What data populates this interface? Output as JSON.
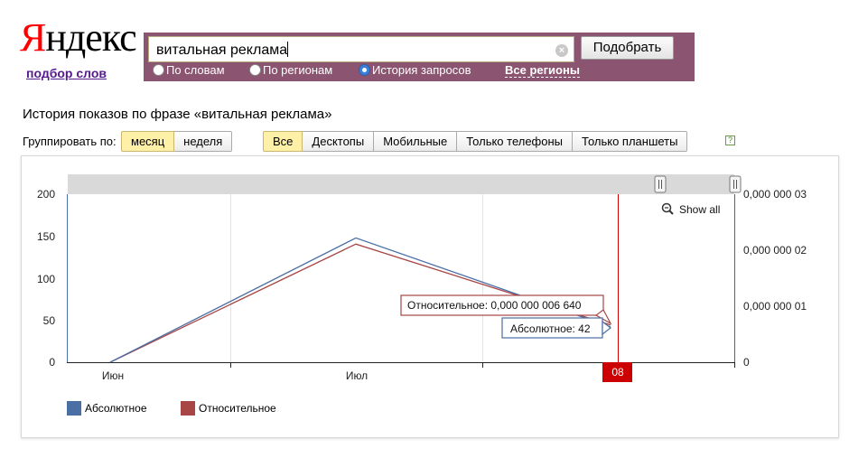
{
  "logo": {
    "first": "Я",
    "rest": "ндекс"
  },
  "logo_link": "подбор слов",
  "search": {
    "value": "витальная реклама",
    "button": "Подобрать",
    "clear": "×"
  },
  "radios": [
    {
      "label": "По словам",
      "checked": false
    },
    {
      "label": "По регионам",
      "checked": false
    },
    {
      "label": "История запросов",
      "checked": true
    }
  ],
  "regions_link": "Все регионы",
  "history_title": "История показов по фразе «витальная реклама»",
  "group_by": {
    "label": "Группировать по:",
    "options": [
      "месяц",
      "неделя"
    ],
    "active": "месяц"
  },
  "device_filter": {
    "options": [
      "Все",
      "Десктопы",
      "Мобильные",
      "Только телефоны",
      "Только планшеты"
    ],
    "active": "Все"
  },
  "help_icon": "?",
  "colors": {
    "absolute": "#4a6fa5",
    "relative": "#a84545",
    "panel": "#8b5470",
    "marker": "#cc0000"
  },
  "chart_data": {
    "type": "line",
    "categories": [
      "Июн",
      "Июл",
      "Авг"
    ],
    "series": [
      {
        "name": "Абсолютное",
        "values": [
          0,
          148,
          42
        ]
      },
      {
        "name": "Относительное",
        "values": [
          0,
          2.11e-08,
          6.64e-09
        ]
      }
    ],
    "y_left": {
      "ticks": [
        "0",
        "50",
        "100",
        "150",
        "200"
      ],
      "range": [
        0,
        200
      ]
    },
    "y_right": {
      "ticks": [
        "0",
        "0,000 000 01",
        "0,000 000 02",
        "0,000 000 03"
      ],
      "range": [
        0,
        3e-08
      ]
    },
    "show_all": "Show all",
    "tooltip_relative": "Относительное: 0,000 000 006 640",
    "tooltip_absolute": "Абсолютное: 42",
    "marker_label": "08",
    "legend": [
      "Абсолютное",
      "Относительное"
    ]
  }
}
